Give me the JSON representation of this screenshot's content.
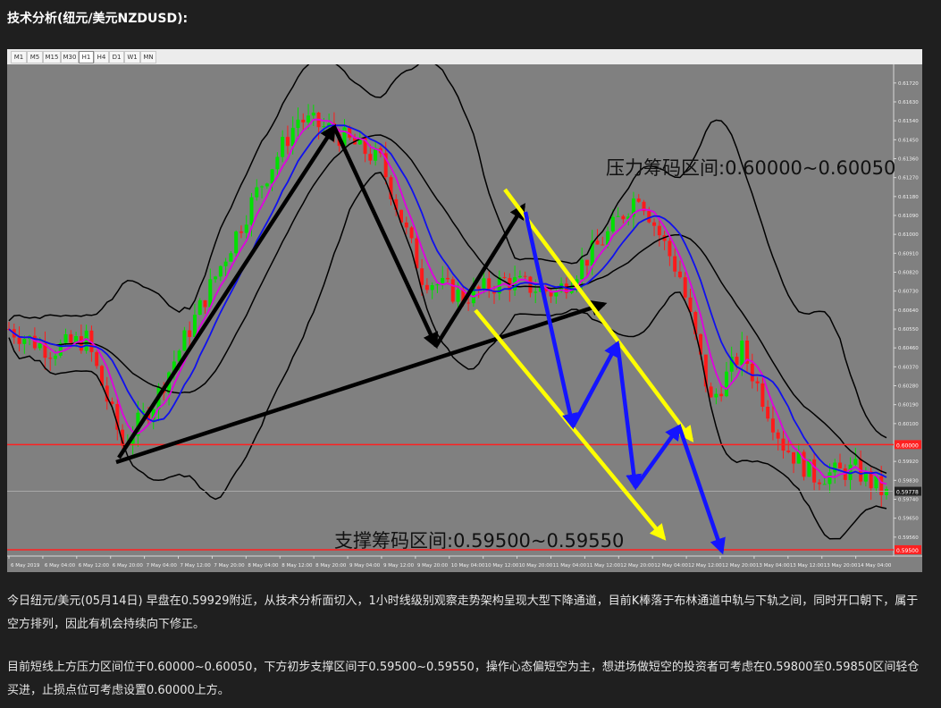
{
  "heading": "技术分析(纽元/美元NZDUSD):",
  "toolbar": {
    "timeframes": [
      "M1",
      "M5",
      "M15",
      "M30",
      "H1",
      "H4",
      "D1",
      "W1",
      "MN"
    ]
  },
  "chart_data": {
    "type": "candlestick",
    "symbol": "NZDUSD",
    "timeframe": "H1",
    "ylim": [
      0.5947,
      0.618
    ],
    "y_ticks": [
      "0.61720",
      "0.61630",
      "0.61540",
      "0.61450",
      "0.61360",
      "0.61270",
      "0.61180",
      "0.61090",
      "0.61000",
      "0.60910",
      "0.60820",
      "0.60730",
      "0.60640",
      "0.60550",
      "0.60460",
      "0.60370",
      "0.60280",
      "0.60190",
      "0.60100",
      "0.59920",
      "0.59830",
      "0.59740",
      "0.59650",
      "0.59560"
    ],
    "x_ticks": [
      "6 May 2019",
      "6 May 04:00",
      "6 May 12:00",
      "6 May 20:00",
      "7 May 04:00",
      "7 May 12:00",
      "7 May 20:00",
      "8 May 04:00",
      "8 May 12:00",
      "8 May 20:00",
      "9 May 04:00",
      "9 May 12:00",
      "9 May 20:00",
      "10 May 04:00",
      "10 May 12:00",
      "10 May 20:00",
      "11 May 04:00",
      "11 May 12:00",
      "12 May 20:00",
      "12 May 04:00",
      "12 May 12:00",
      "12 May 20:00",
      "13 May 04:00",
      "13 May 12:00",
      "13 May 20:00",
      "14 May 04:00"
    ],
    "current_price": "0.59778",
    "price_lines": [
      {
        "label": "0.60000",
        "value": 0.6,
        "color": "#ff2020"
      },
      {
        "label": "0.59500",
        "value": 0.595,
        "color": "#ff2020"
      }
    ],
    "annotations": {
      "resistance": "压力筹码区间:0.60000~0.60050",
      "support": "支撑筹码区间:0.59500~0.59550"
    },
    "candle_colors": {
      "up": "#00e000",
      "down": "#ff1a1a"
    },
    "indicator_colors": {
      "bollinger": "#000000",
      "ma_fast": "#e000e0",
      "ma_slow": "#1010ee"
    },
    "arrow_colors": {
      "trend": "#000000",
      "impulse": "#1414ff",
      "channel": "#ffff00"
    },
    "waypoints": [
      [
        0,
        0.6055
      ],
      [
        8,
        0.6045
      ],
      [
        15,
        0.605
      ],
      [
        22,
        0.6
      ],
      [
        28,
        0.602
      ],
      [
        38,
        0.607
      ],
      [
        48,
        0.612
      ],
      [
        56,
        0.6155
      ],
      [
        62,
        0.615
      ],
      [
        72,
        0.6135
      ],
      [
        80,
        0.608
      ],
      [
        88,
        0.607
      ],
      [
        96,
        0.6078
      ],
      [
        106,
        0.6072
      ],
      [
        116,
        0.61
      ],
      [
        122,
        0.612
      ],
      [
        130,
        0.608
      ],
      [
        136,
        0.602
      ],
      [
        142,
        0.6045
      ],
      [
        150,
        0.6
      ],
      [
        156,
        0.5985
      ],
      [
        164,
        0.5988
      ],
      [
        170,
        0.5976
      ]
    ]
  },
  "paragraphs": [
    "今日纽元/美元(05月14日) 早盘在0.59929附近，从技术分析面切入，1小时线级别观察走势架构呈现大型下降通道，目前K棒落于布林通道中轨与下轨之间，同时开口朝下，属于空方排列，因此有机会持续向下修正。",
    "目前短线上方压力区间位于0.60000~0.60050，下方初步支撑区间于0.59500~0.59550，操作心态偏短空为主，想进场做短空的投资者可考虑在0.59800至0.59850区间轻仓买进，止损点位可考虑设置0.60000上方。"
  ]
}
